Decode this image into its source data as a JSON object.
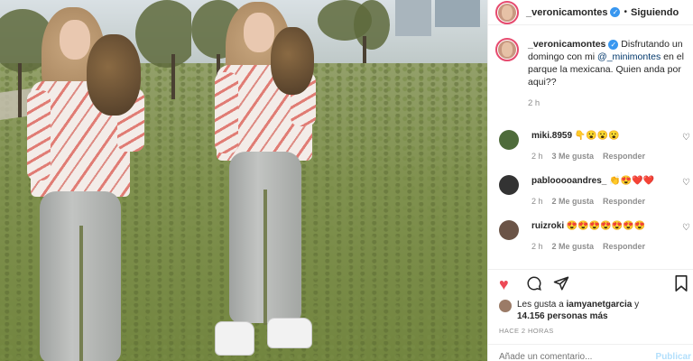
{
  "post": {
    "username": "_veronicamontes",
    "follow_status": "Siguiendo",
    "caption": {
      "username": "_veronicamontes",
      "text_before": " Disfrutando un domingo con mi ",
      "mention": "@_minimontes",
      "text_after": " en el parque la mexicana. Quien anda por aqui??",
      "time": "2 h"
    },
    "comments": [
      {
        "username": "miki.8959",
        "text": "👇😮😮😮",
        "time": "2 h",
        "likes": "3 Me gusta",
        "reply": "Responder",
        "avatar_color": "#4e6b3a"
      },
      {
        "username": "pablooooandres_",
        "text": "👏😍❤️❤️",
        "time": "2 h",
        "likes": "2 Me gusta",
        "reply": "Responder",
        "avatar_color": "#333333"
      },
      {
        "username": "ruizroki",
        "text": "😍😍😍😍😍😍😍",
        "time": "2 h",
        "likes": "2 Me gusta",
        "reply": "Responder",
        "avatar_color": "#6b5447"
      }
    ],
    "likes_text_prefix": "Les gusta a ",
    "likes_user": "iamyanetgarcia",
    "likes_text_mid": " y",
    "likes_count": "14.156 personas más",
    "posted_ago": "HACE 2 HORAS",
    "comment_placeholder": "Añade un comentario...",
    "publish_label": "Publicar"
  },
  "colors": {
    "like_red": "#ed4956",
    "verified_blue": "#3897f0",
    "story_ring": "#e64a6e",
    "secondary_text": "#8e8e8e"
  },
  "icons": [
    "verified-badge-icon",
    "heart-filled-icon",
    "comment-icon",
    "share-icon",
    "bookmark-icon",
    "heart-outline-icon"
  ]
}
